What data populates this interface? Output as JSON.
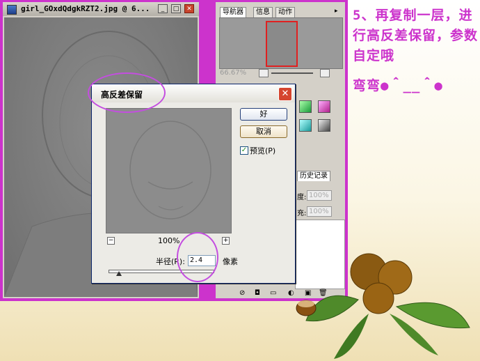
{
  "document": {
    "title": "girl_GOxdQdgkRZT2.jpg @ 6...",
    "btn_min": "_",
    "btn_max": "□",
    "btn_close": "✕"
  },
  "palettes": {
    "tabs": [
      "导航器",
      "信息",
      "动作"
    ],
    "zoom": "66.67%",
    "history_tab": "历史记录",
    "opacity_label": "度:",
    "opacity_value": "100%",
    "fill_label": "充:",
    "fill_value": "100%"
  },
  "dialog": {
    "title": "高反差保留",
    "ok_label": "好",
    "cancel_label": "取消",
    "preview_label": "预览",
    "preview_shortcut": "(P)",
    "preview_checked": true,
    "zoom_level": "100%",
    "zoom_out": "−",
    "zoom_in": "+",
    "radius_label": "半径(R):",
    "radius_value": "2.4",
    "radius_unit": "像素",
    "radius_slider_fraction": 0.1
  },
  "annotation": {
    "step_text": "5、再复制一层，进行高反差保留，参数自定哦",
    "emoticon_line": "弯弯●＾__＾●"
  },
  "colors": {
    "frame": "#cc33cc",
    "highlight_circle": "#c44ee0",
    "text_accent": "#cc33cc"
  }
}
